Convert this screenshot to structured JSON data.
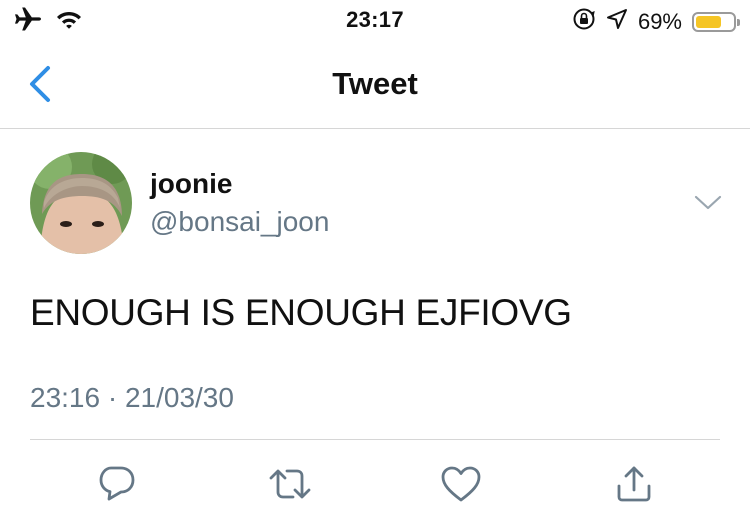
{
  "status_bar": {
    "time": "23:17",
    "battery_percent": "69%",
    "battery_level": 0.69,
    "battery_color": "#f5c525",
    "icons": [
      "airplane-icon",
      "wifi-icon",
      "orientation-lock-icon",
      "location-icon",
      "battery-icon"
    ]
  },
  "nav": {
    "title": "Tweet",
    "back_icon": "chevron-left-icon",
    "accent_color": "#2f8ee5"
  },
  "tweet": {
    "display_name": "joonie",
    "handle": "@bonsai_joon",
    "text": "ENOUGH IS ENOUGH EJFIOVG",
    "timestamp": "23:16 · 21/03/30",
    "more_icon": "chevron-down-icon"
  },
  "actions": [
    {
      "name": "reply",
      "icon": "reply-icon"
    },
    {
      "name": "retweet",
      "icon": "retweet-icon"
    },
    {
      "name": "like",
      "icon": "heart-icon"
    },
    {
      "name": "share",
      "icon": "share-icon"
    }
  ],
  "colors": {
    "secondary_text": "#657786",
    "icon_gray": "#657786",
    "divider": "#d6d6d6"
  }
}
